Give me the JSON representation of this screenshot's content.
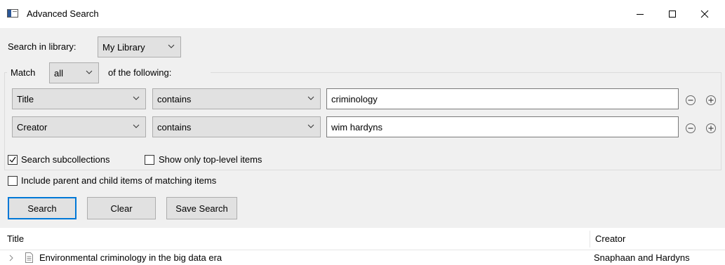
{
  "window": {
    "title": "Advanced Search"
  },
  "search_in": {
    "label": "Search in library:",
    "selected": "My Library"
  },
  "match": {
    "label": "Match",
    "selected": "all",
    "suffix": "of the following:"
  },
  "conditions": [
    {
      "field": "Title",
      "operator": "contains",
      "value": "criminology"
    },
    {
      "field": "Creator",
      "operator": "contains",
      "value": "wim hardyns"
    }
  ],
  "options": {
    "search_subcollections": {
      "label": "Search subcollections",
      "checked": true
    },
    "top_level_only": {
      "label": "Show only top-level items",
      "checked": false
    },
    "include_parent_child": {
      "label": "Include parent and child items of matching items",
      "checked": false
    }
  },
  "buttons": {
    "search": "Search",
    "clear": "Clear",
    "save_search": "Save Search"
  },
  "results": {
    "columns": [
      "Title",
      "Creator"
    ],
    "rows": [
      {
        "title": "Environmental criminology in the big data era",
        "creator": "Snaphaan and Hardyns"
      }
    ]
  },
  "colors": {
    "accent": "#0078d7",
    "window_bg": "#f0f0f0",
    "control_bg": "#e1e1e1"
  }
}
